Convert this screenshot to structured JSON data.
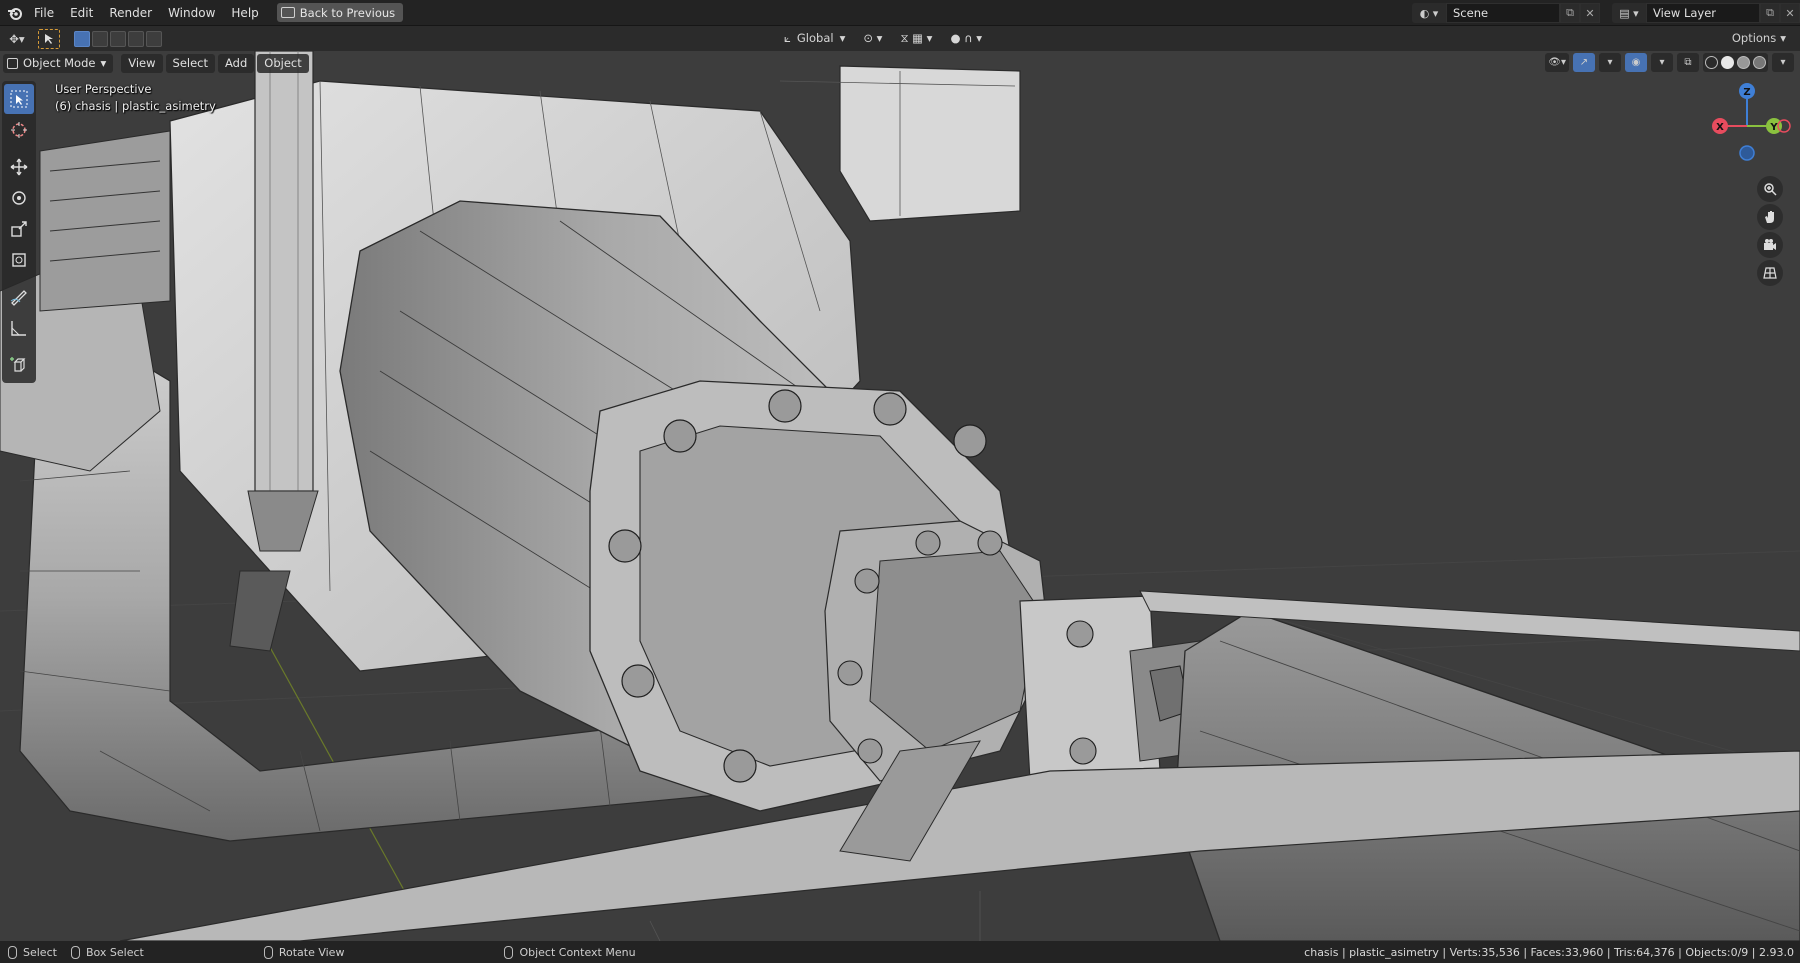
{
  "app": {
    "menu": [
      "File",
      "Edit",
      "Render",
      "Window",
      "Help"
    ],
    "back_button": "Back to Previous",
    "scene_name": "Scene",
    "view_layer_name": "View Layer"
  },
  "header": {
    "transform_orientation": "Global",
    "options_label": "Options"
  },
  "viewport": {
    "mode_label": "Object Mode",
    "menus": [
      "View",
      "Select",
      "Add",
      "Object"
    ],
    "overlay_line1": "User Perspective",
    "overlay_line2": "(6) chasis | plastic_asimetry",
    "gizmo_axes": {
      "x": "X",
      "y": "Y",
      "z": "Z"
    },
    "colors": {
      "x_axis": "#e74c5e",
      "y_axis": "#8ac13f",
      "z_axis": "#3f7fd6",
      "accent": "#4772b3"
    }
  },
  "toolbar": {
    "tools": [
      "select-box-icon",
      "cursor-icon",
      "move-icon",
      "rotate-icon",
      "scale-icon",
      "transform-icon",
      "annotate-icon",
      "measure-icon",
      "add-cube-icon"
    ]
  },
  "statusbar": {
    "select": "Select",
    "box_select": "Box Select",
    "rotate_view": "Rotate View",
    "context_menu": "Object Context Menu",
    "stats": "chasis | plastic_asimetry | Verts:35,536 | Faces:33,960 | Tris:64,376 | Objects:0/9 | 2.93.0"
  }
}
